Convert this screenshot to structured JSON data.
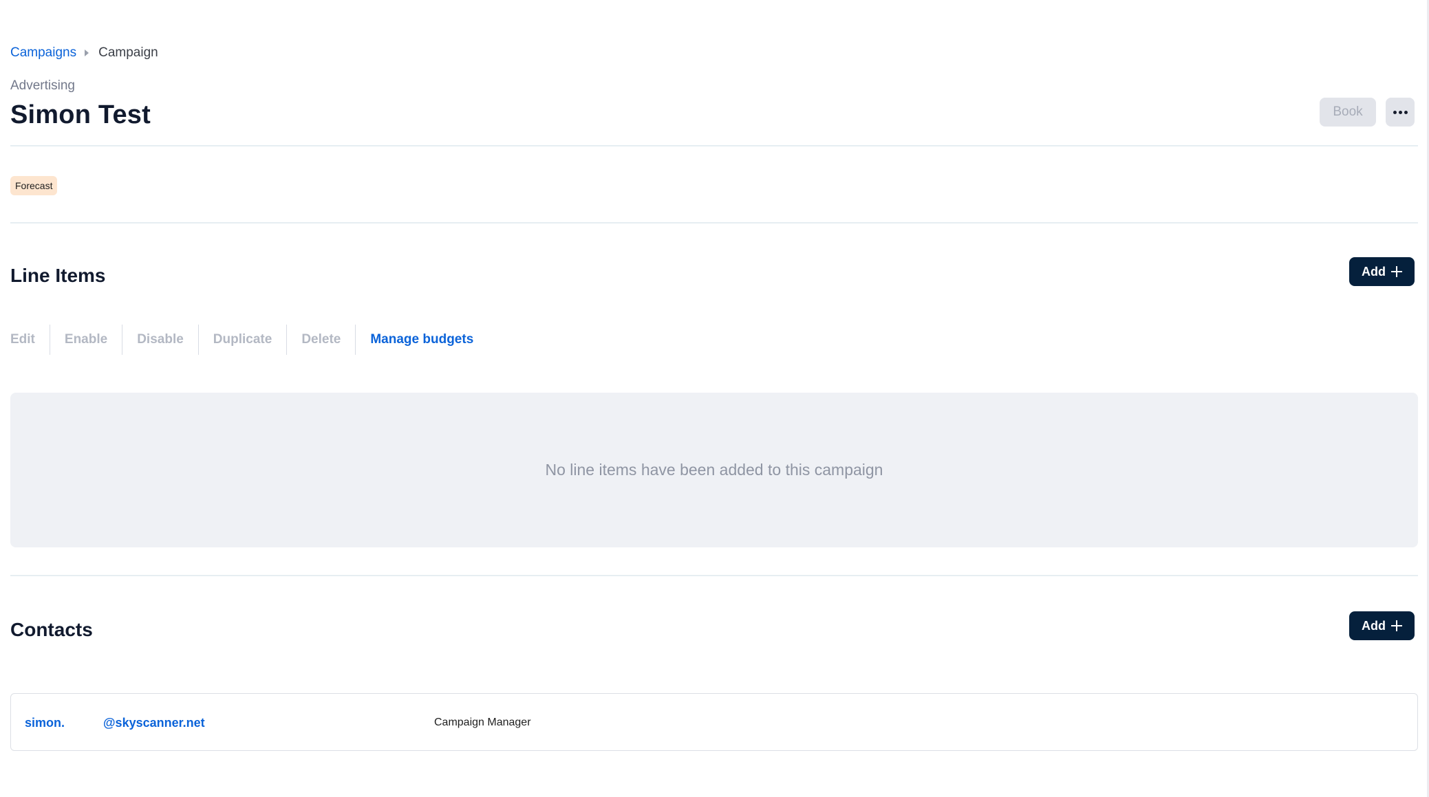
{
  "breadcrumb": {
    "parent": "Campaigns",
    "current": "Campaign"
  },
  "header": {
    "subtitle": "Advertising",
    "title": "Simon Test",
    "book_label": "Book",
    "more_icon": "more-horizontal-icon"
  },
  "status_badge": "Forecast",
  "line_items": {
    "title": "Line Items",
    "add_label": "Add",
    "toolbar": {
      "edit": "Edit",
      "enable": "Enable",
      "disable": "Disable",
      "duplicate": "Duplicate",
      "delete": "Delete",
      "manage_budgets": "Manage budgets"
    },
    "empty_message": "No line items have been added to this campaign"
  },
  "contacts": {
    "title": "Contacts",
    "add_label": "Add",
    "items": [
      {
        "name": "simon.",
        "email": "@skyscanner.net",
        "role": "Campaign Manager"
      }
    ]
  },
  "colors": {
    "link": "#0b63d9",
    "primary_button": "#05203c",
    "disabled_button": "#e2e4ea",
    "badge": "#fde5cf",
    "empty_bg": "#eff1f5"
  }
}
